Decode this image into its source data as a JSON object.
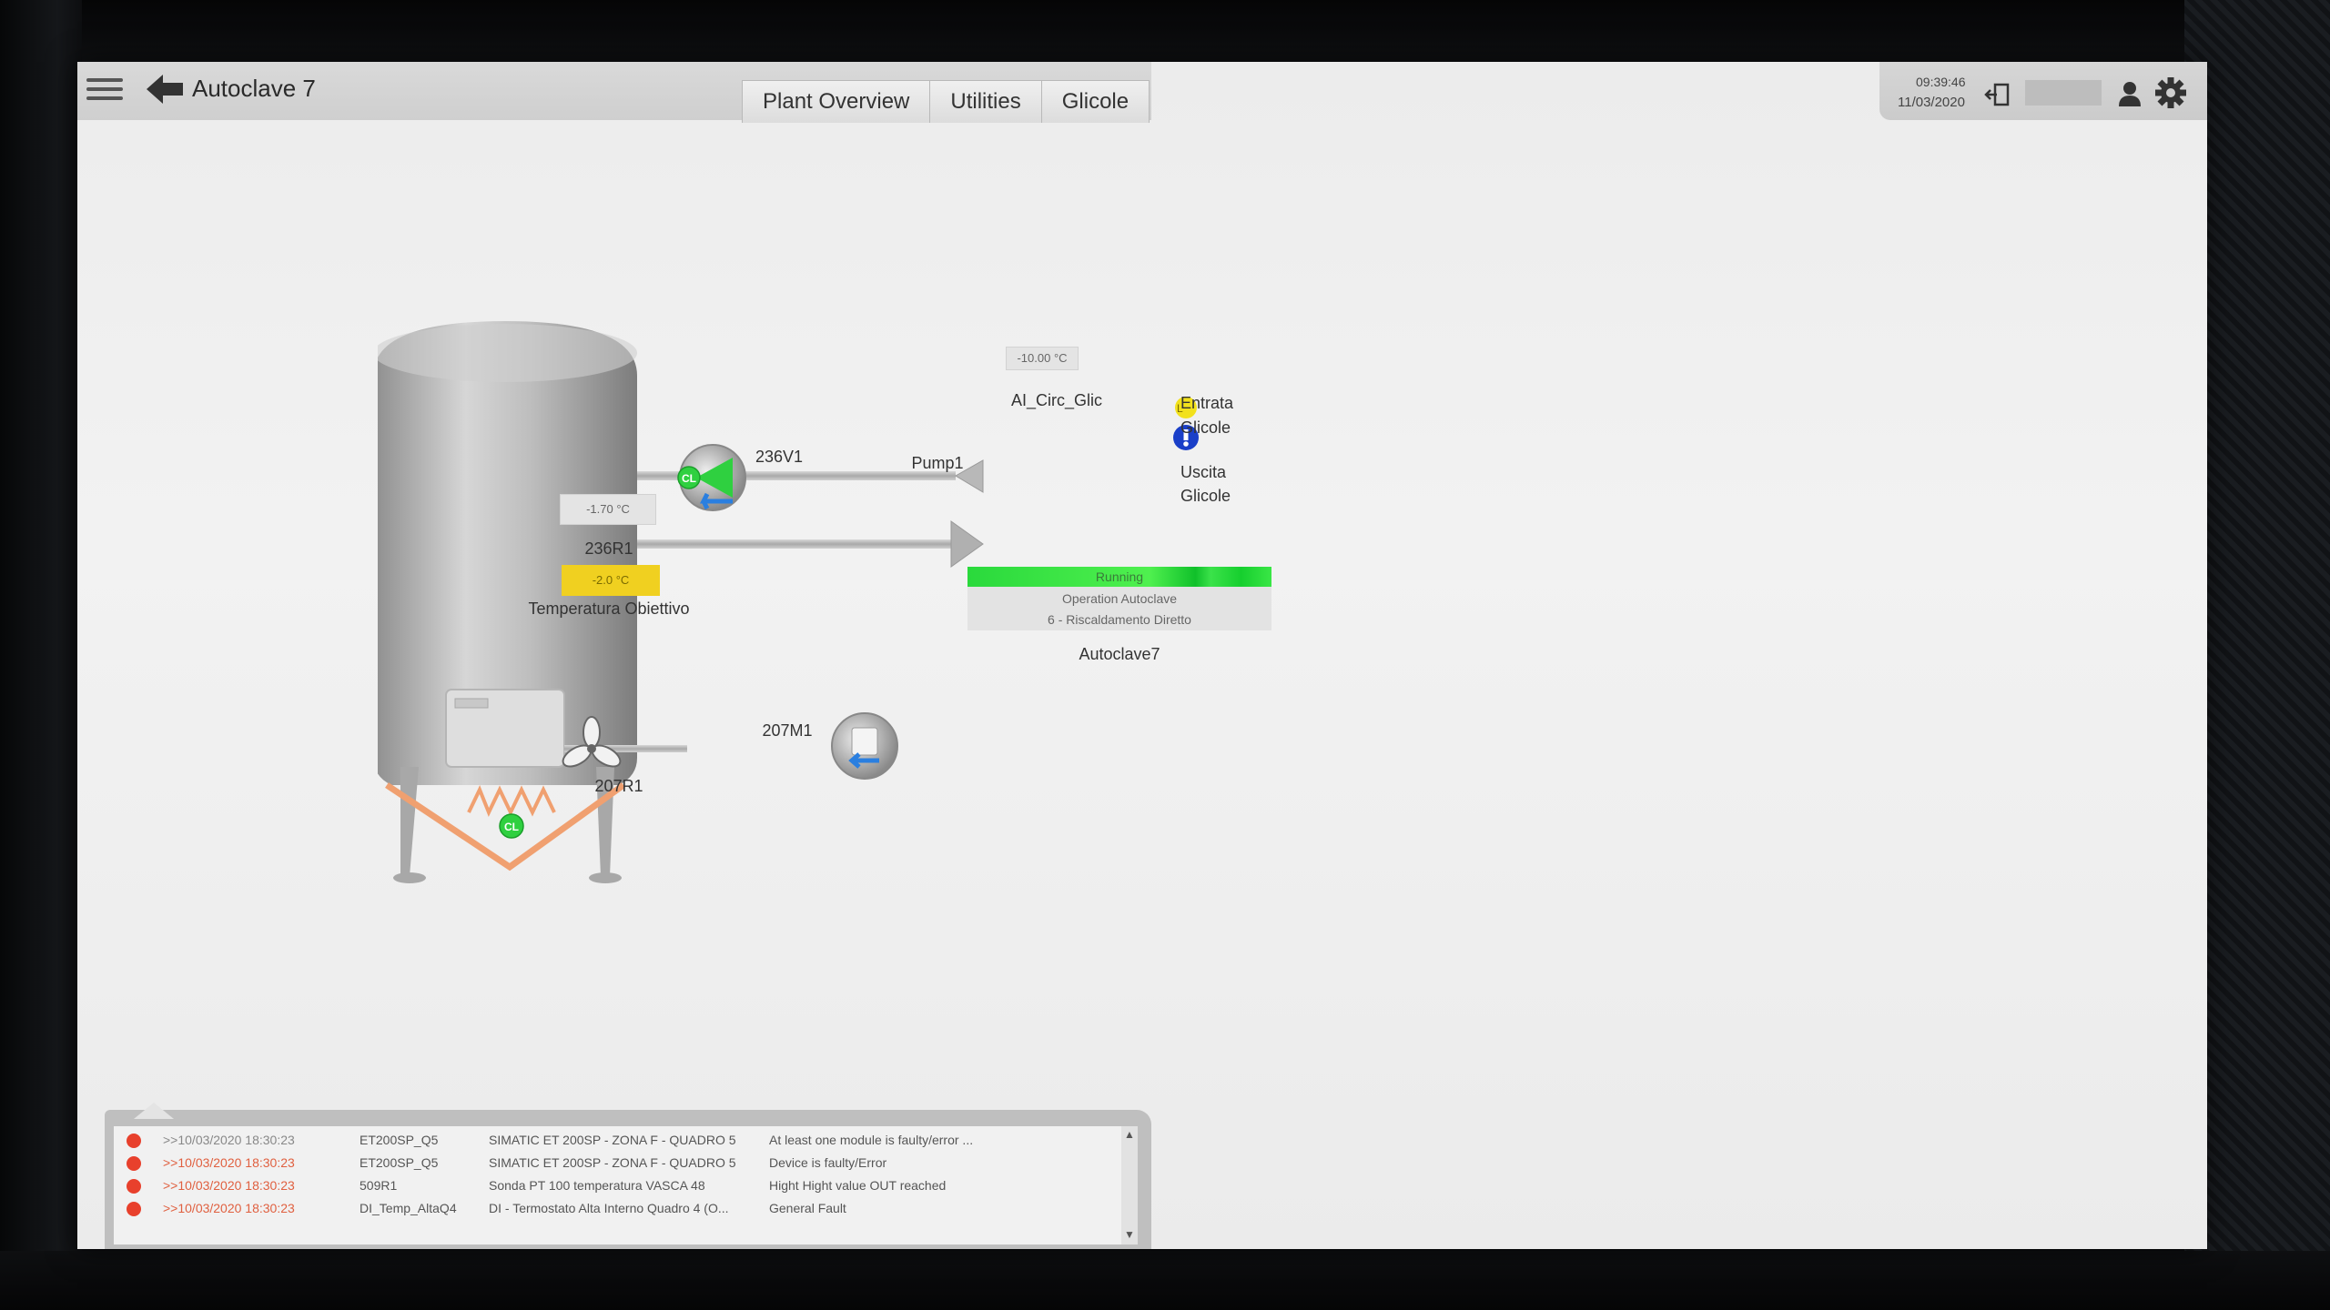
{
  "header": {
    "title": "Autoclave 7",
    "tabs": [
      "Plant Overview",
      "Utilities",
      "Glicole"
    ],
    "time": "09:39:46",
    "date": "11/03/2020"
  },
  "process": {
    "valve_label": "236V1",
    "pump_label": "Pump1",
    "glycol_temp": "-10.00 °C",
    "glycol_tag": "AI_Circ_Glic",
    "inlet": [
      "Entrata",
      "Glicole"
    ],
    "outlet": [
      "Uscita",
      "Glicole"
    ],
    "tank_temp": "-1.70 °C",
    "tank_label": "236R1",
    "target_temp": "-2.0 °C",
    "target_label": "Temperatura Obiettivo",
    "motor_label": "207M1",
    "heater_label": "207R1",
    "alarm_badge": "L"
  },
  "status": {
    "state": "Running",
    "operation": "Operation Autoclave",
    "step": "6 - Riscaldamento Diretto",
    "unit": "Autoclave7"
  },
  "alarms": [
    {
      "timestamp": ">>10/03/2020 18:30:23",
      "tag": "ET200SP_Q5",
      "description": "SIMATIC ET 200SP - ZONA F - QUADRO 5",
      "message": "At least one module is faulty/error ..."
    },
    {
      "timestamp": ">>10/03/2020 18:30:23",
      "tag": "ET200SP_Q5",
      "description": "SIMATIC ET 200SP - ZONA F - QUADRO 5",
      "message": "Device is faulty/Error"
    },
    {
      "timestamp": ">>10/03/2020 18:30:23",
      "tag": "509R1",
      "description": "Sonda PT 100 temperatura VASCA 48",
      "message": "Hight Hight value OUT reached"
    },
    {
      "timestamp": ">>10/03/2020 18:30:23",
      "tag": "DI_Temp_AltaQ4",
      "description": "DI - Termostato Alta Interno Quadro 4 (O...",
      "message": "General Fault"
    }
  ],
  "colors": {
    "running": "#22d83a",
    "setpoint": "#f0d020",
    "alarm": "#e8402c",
    "pump_accent": "#2a7fe0",
    "heater": "#f0a070"
  }
}
